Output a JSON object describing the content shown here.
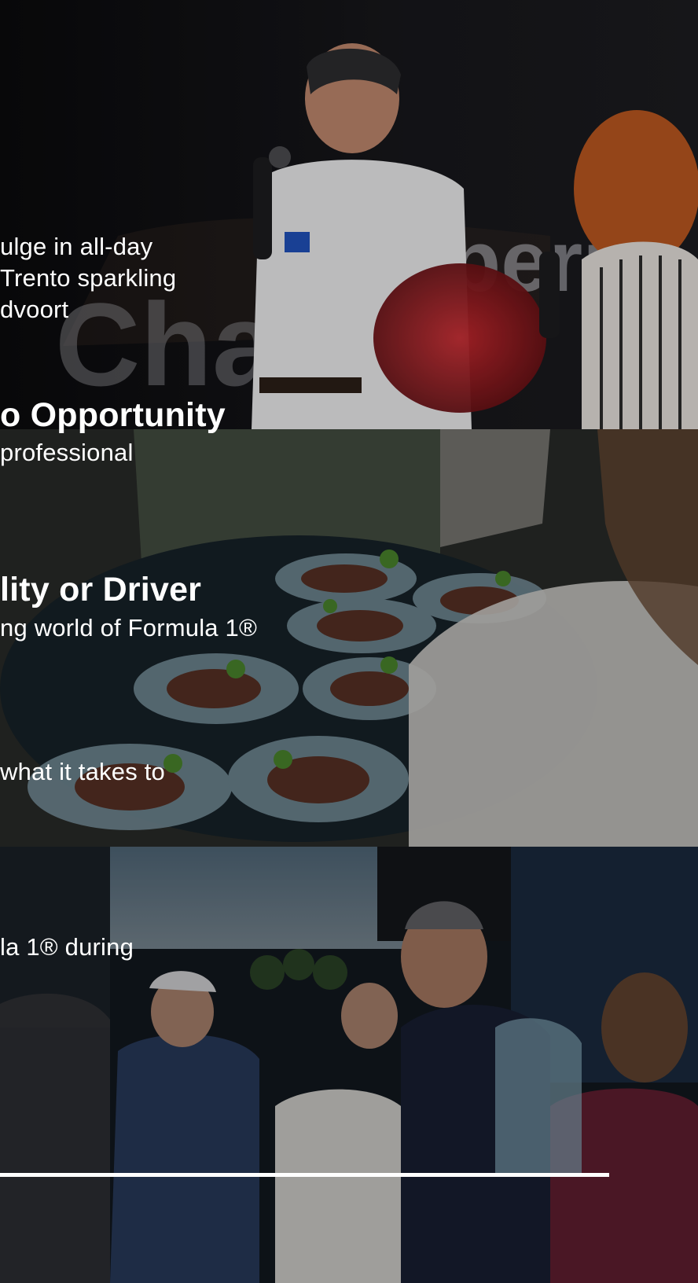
{
  "slides": {
    "paragraph1": {
      "line1": "ulge in all-day",
      "line2": "Trento sparkling",
      "line3": "dvoort"
    },
    "heading1": "o Opportunity",
    "paragraph2": {
      "line1": "professional"
    },
    "heading2": "lity or Driver",
    "paragraph3": {
      "line1": "ng world of Formula 1®"
    },
    "paragraph4": {
      "line1": "what it takes to"
    },
    "paragraph5": {
      "line1": "la 1® during"
    }
  },
  "progress": {
    "fraction": 0.873
  },
  "icons": [
    "hospitality-photo",
    "food-platter-photo",
    "paddock-crowd-photo"
  ],
  "colors": {
    "background": "#0b0b0d",
    "text": "#ffffff",
    "progress": "#ffffff"
  }
}
